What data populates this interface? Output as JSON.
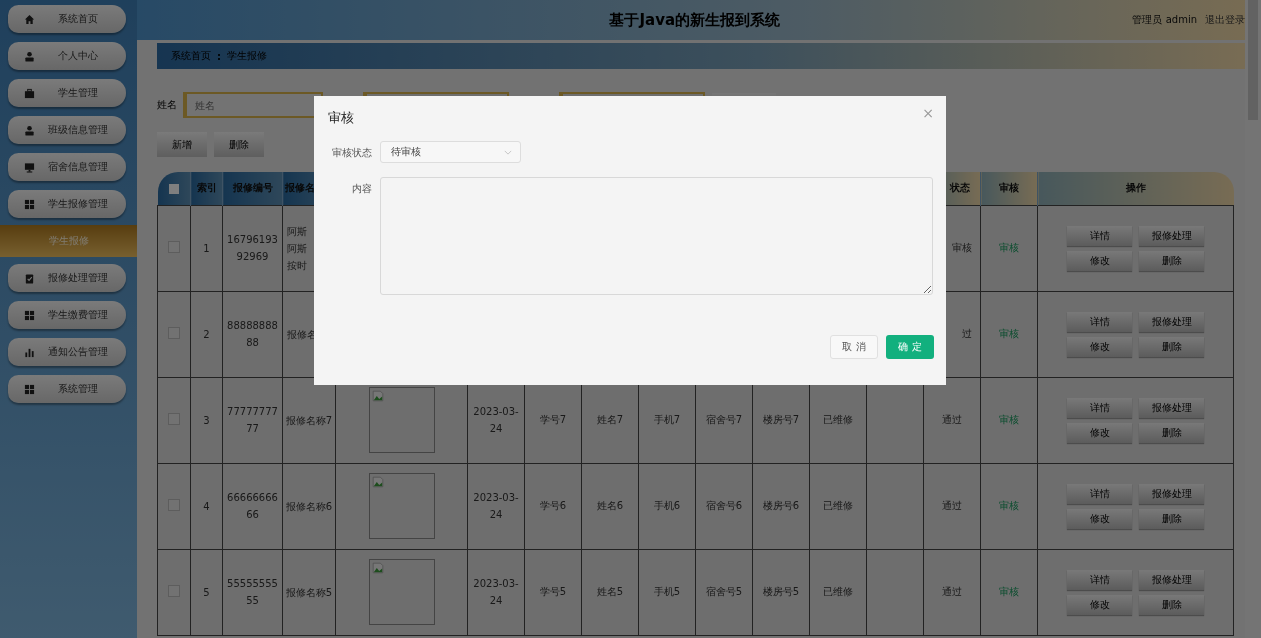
{
  "header": {
    "title": "基于Java的新生报到系统",
    "user": "管理员 admin",
    "logout": "退出登录"
  },
  "sidebar": {
    "items": [
      {
        "label": "系统首页",
        "kind": "home",
        "selected": false
      },
      {
        "label": "个人中心",
        "kind": "user",
        "selected": false
      },
      {
        "label": "学生管理",
        "kind": "briefcase",
        "selected": false
      },
      {
        "label": "班级信息管理",
        "kind": "user",
        "selected": false
      },
      {
        "label": "宿舍信息管理",
        "kind": "monitor",
        "selected": false
      },
      {
        "label": "学生报修管理",
        "kind": "grid",
        "selected": false
      },
      {
        "label": "学生报修",
        "kind": "sub",
        "selected": true
      },
      {
        "label": "报修处理管理",
        "kind": "clipboard",
        "selected": false
      },
      {
        "label": "学生缴费管理",
        "kind": "grid",
        "selected": false
      },
      {
        "label": "通知公告管理",
        "kind": "chart",
        "selected": false
      },
      {
        "label": "系统管理",
        "kind": "grid",
        "selected": false
      }
    ]
  },
  "breadcrumb": [
    "系统首页",
    "学生报修"
  ],
  "breadcrumb_separator": ":",
  "search": {
    "label": "姓名",
    "placeholder": "姓名"
  },
  "actions": [
    "新增",
    "删除"
  ],
  "table": {
    "header": {
      "checked": false,
      "left": [
        "索引",
        "报修编号",
        "报修名"
      ],
      "right": [
        "状态",
        "审核",
        "操作"
      ]
    },
    "rows": [
      {
        "kind": "partial",
        "checked": false,
        "index": "1",
        "number": "1679619392969",
        "name_lines": [
          "阿斯",
          "阿斯",
          "按时"
        ],
        "audit_status": "审核",
        "audit_link": "审核",
        "buttons": [
          "详情",
          "报修处理",
          "修改",
          "删除"
        ]
      },
      {
        "kind": "partial",
        "checked": false,
        "index": "2",
        "number": "8888888888",
        "name_lines": [
          "报修名"
        ],
        "audit_status": "过",
        "audit_link": "审核",
        "buttons": [
          "详情",
          "报修处理",
          "修改",
          "删除"
        ]
      },
      {
        "kind": "full",
        "checked": false,
        "index": "3",
        "number": "7777777777",
        "name": "报修名称7",
        "date": "2023-03-24",
        "student_no": "学号7",
        "student_name": "姓名7",
        "phone": "手机7",
        "dorm": "宿舍号7",
        "building": "楼房号7",
        "repair_status": "已维修",
        "audit_status": "通过",
        "audit_link": "审核",
        "buttons": [
          "详情",
          "报修处理",
          "修改",
          "删除"
        ]
      },
      {
        "kind": "full",
        "checked": false,
        "index": "4",
        "number": "6666666666",
        "name": "报修名称6",
        "date": "2023-03-24",
        "student_no": "学号6",
        "student_name": "姓名6",
        "phone": "手机6",
        "dorm": "宿舍号6",
        "building": "楼房号6",
        "repair_status": "已维修",
        "audit_status": "通过",
        "audit_link": "审核",
        "buttons": [
          "详情",
          "报修处理",
          "修改",
          "删除"
        ]
      },
      {
        "kind": "full",
        "checked": false,
        "index": "5",
        "number": "5555555555",
        "name": "报修名称5",
        "date": "2023-03-24",
        "student_no": "学号5",
        "student_name": "姓名5",
        "phone": "手机5",
        "dorm": "宿舍号5",
        "building": "楼房号5",
        "repair_status": "已维修",
        "audit_status": "通过",
        "audit_link": "审核",
        "buttons": [
          "详情",
          "报修处理",
          "修改",
          "删除"
        ]
      }
    ]
  },
  "dialog": {
    "title": "审核",
    "close": "×",
    "status_label": "审核状态",
    "status_value": "待审核",
    "content_label": "内容",
    "cancel": "取 消",
    "confirm": "确 定"
  }
}
